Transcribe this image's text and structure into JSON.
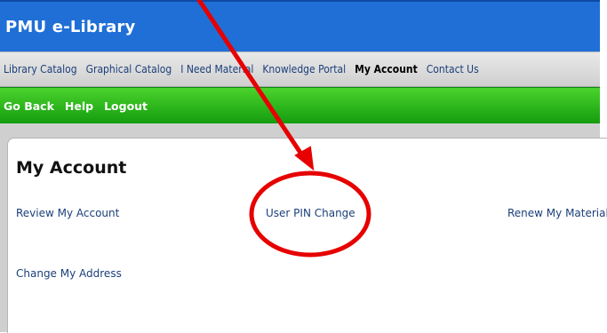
{
  "app": {
    "title": "PMU e-Library"
  },
  "navigation": {
    "items": [
      {
        "label": "Library Catalog",
        "active": false
      },
      {
        "label": "Graphical Catalog",
        "active": false
      },
      {
        "label": "I Need Material",
        "active": false
      },
      {
        "label": "Knowledge Portal",
        "active": false
      },
      {
        "label": "My Account",
        "active": true
      },
      {
        "label": "Contact Us",
        "active": false
      }
    ]
  },
  "toolbar": {
    "items": [
      {
        "label": "Go Back"
      },
      {
        "label": "Help"
      },
      {
        "label": "Logout"
      }
    ]
  },
  "main": {
    "title": "My Account",
    "links": {
      "review": "Review My Account",
      "pin": "User PIN Change",
      "renew": "Renew My Materials",
      "address": "Change My Address"
    }
  },
  "colors": {
    "header_blue": "#1f6fd6",
    "nav_gray": "#d8d8d8",
    "toolbar_green": "#1fb417",
    "link_blue": "#1b3f7a",
    "annotation_red": "#e60000"
  },
  "icons": {
    "arrow": "annotation-arrow",
    "circle": "annotation-circle"
  }
}
